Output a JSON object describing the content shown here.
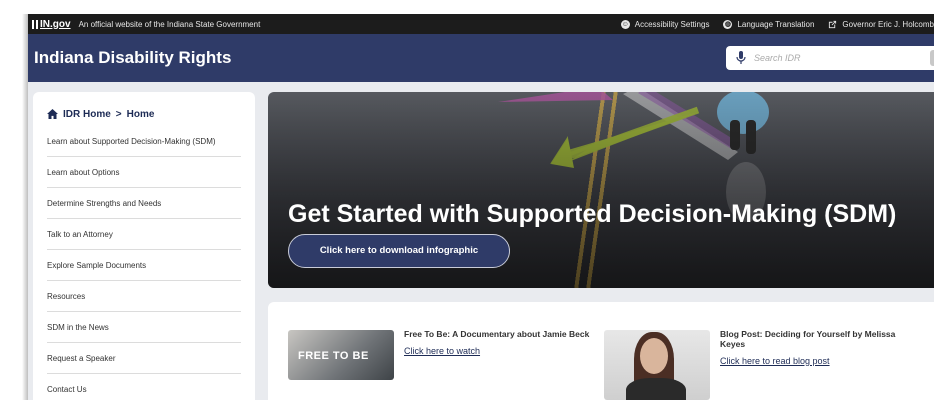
{
  "topbar": {
    "logo": "IN.gov",
    "official": "An official website of the Indiana State Government",
    "accessibility": "Accessibility Settings",
    "language": "Language Translation",
    "governor": "Governor Eric J. Holcomb"
  },
  "header": {
    "title": "Indiana Disability Rights",
    "search_placeholder": "Search IDR"
  },
  "breadcrumb": {
    "root": "IDR Home",
    "separator": ">",
    "current": "Home"
  },
  "sidebar": {
    "items": [
      {
        "label": "Learn about Supported Decision-Making (SDM)"
      },
      {
        "label": "Learn about Options"
      },
      {
        "label": "Determine Strengths and Needs"
      },
      {
        "label": "Talk to an Attorney"
      },
      {
        "label": "Explore Sample Documents"
      },
      {
        "label": "Resources"
      },
      {
        "label": "SDM in the News"
      },
      {
        "label": "Request a Speaker"
      },
      {
        "label": "Contact Us"
      }
    ]
  },
  "hero": {
    "title": "Get Started with Supported Decision-Making (SDM)",
    "button": "Click here to download infographic"
  },
  "cards": [
    {
      "thumb_text": "FREE TO BE",
      "title": "Free To Be: A Documentary about Jamie Beck",
      "link": "Click here to watch"
    },
    {
      "title": "Blog Post: Deciding for Yourself by Melissa Keyes",
      "link": "Click here to read blog post"
    }
  ],
  "colors": {
    "navy": "#2f3b68",
    "topbar": "#1c1c1c",
    "page_bg": "#e9ebef"
  }
}
